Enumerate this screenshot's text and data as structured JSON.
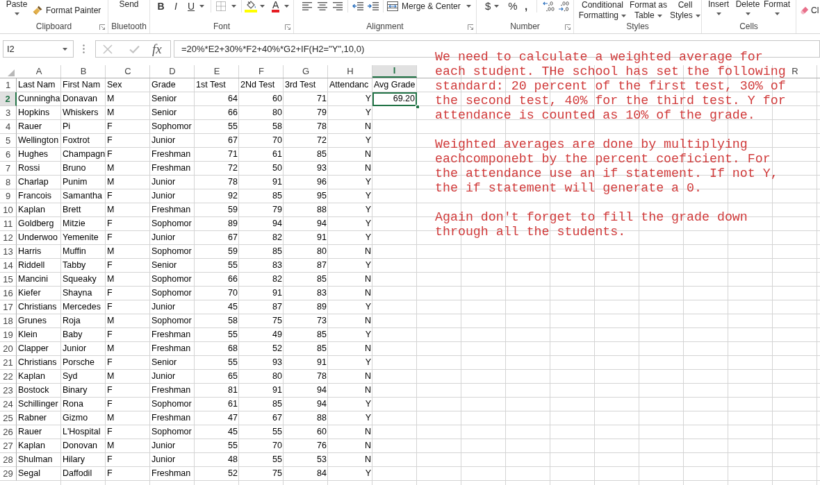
{
  "ribbon": {
    "clipboard": {
      "paste": "Paste",
      "format_painter": "Format Painter",
      "label": "Clipboard"
    },
    "bluetooth": {
      "send": "Send",
      "label": "Bluetooth"
    },
    "font": {
      "bold": "B",
      "italic": "I",
      "underline": "U",
      "font_color": "A",
      "label": "Font"
    },
    "alignment": {
      "merge": "Merge & Center",
      "label": "Alignment"
    },
    "number": {
      "currency": "$",
      "percent": "%",
      "comma": ",",
      "label": "Number"
    },
    "styles": {
      "buttons": [
        "Conditional Formatting",
        "Format as Table",
        "Cell Styles"
      ],
      "label": "Styles"
    },
    "cells": {
      "buttons": [
        "Insert",
        "Delete",
        "Format"
      ],
      "label": "Cells"
    },
    "editing": {
      "clear": "Cl"
    }
  },
  "formula_bar": {
    "name_box": "I2",
    "function_button": "fx",
    "formula": "=20%*E2+30%*F2+40%*G2+IF(H2=\"Y\",10,0)"
  },
  "sheet": {
    "columns": [
      {
        "label": "A",
        "kind": "text",
        "selected": false
      },
      {
        "label": "B",
        "kind": "text",
        "selected": false
      },
      {
        "label": "C",
        "kind": "text",
        "selected": false
      },
      {
        "label": "D",
        "kind": "text",
        "selected": false
      },
      {
        "label": "E",
        "kind": "numeric",
        "selected": false
      },
      {
        "label": "F",
        "kind": "numeric",
        "selected": false
      },
      {
        "label": "G",
        "kind": "numeric",
        "selected": false
      },
      {
        "label": "H",
        "kind": "flag",
        "selected": false
      },
      {
        "label": "I",
        "kind": "numeric",
        "selected": true
      },
      {
        "selected": false
      },
      {
        "selected": false
      },
      {
        "selected": false
      },
      {
        "selected": false
      },
      {
        "selected": false
      },
      {
        "selected": false
      },
      {
        "selected": false
      },
      {
        "selected": false
      },
      {
        "label": "R",
        "selected": false
      }
    ],
    "rows": [
      {
        "label": "1",
        "kind": "header",
        "selected": false,
        "cells": [
          "Last Nam",
          "First Nam",
          "Sex",
          "Grade",
          "1st Test",
          "2Nd Test",
          "3rd Test",
          "Attendanc",
          "Avg Grade"
        ]
      },
      {
        "label": "2",
        "kind": "data",
        "selected": true,
        "cells": [
          "Cunningha",
          "Donavan",
          "M",
          "Senior",
          "64",
          "60",
          "71",
          "Y",
          "69.20"
        ]
      },
      {
        "label": "3",
        "kind": "data",
        "selected": false,
        "cells": [
          "Hopkins",
          "Whiskers",
          "M",
          "Senior",
          "66",
          "80",
          "79",
          "Y"
        ]
      },
      {
        "label": "4",
        "kind": "data",
        "selected": false,
        "cells": [
          "Rauer",
          "Pi",
          "F",
          "Sophomor",
          "55",
          "58",
          "78",
          "N"
        ]
      },
      {
        "label": "5",
        "kind": "data",
        "selected": false,
        "cells": [
          "Wellington",
          "Foxtrot",
          "F",
          "Junior",
          "67",
          "70",
          "72",
          "Y"
        ]
      },
      {
        "label": "6",
        "kind": "data",
        "selected": false,
        "cells": [
          "Hughes",
          "Champagn",
          "F",
          "Freshman",
          "71",
          "61",
          "85",
          "N"
        ]
      },
      {
        "label": "7",
        "kind": "data",
        "selected": false,
        "cells": [
          "Rossi",
          "Bruno",
          "M",
          "Freshman",
          "72",
          "50",
          "93",
          "N"
        ]
      },
      {
        "label": "8",
        "kind": "data",
        "selected": false,
        "cells": [
          "Charlap",
          "Punim",
          "M",
          "Junior",
          "78",
          "91",
          "96",
          "Y"
        ]
      },
      {
        "label": "9",
        "kind": "data",
        "selected": false,
        "cells": [
          "Francois",
          "Samantha",
          "F",
          "Junior",
          "92",
          "85",
          "95",
          "Y"
        ]
      },
      {
        "label": "10",
        "kind": "data",
        "selected": false,
        "cells": [
          "Kaplan",
          "Brett",
          "M",
          "Freshman",
          "59",
          "79",
          "88",
          "Y"
        ]
      },
      {
        "label": "11",
        "kind": "data",
        "selected": false,
        "cells": [
          "Goldberg",
          "Mitzie",
          "F",
          "Sophomor",
          "89",
          "94",
          "94",
          "Y"
        ]
      },
      {
        "label": "12",
        "kind": "data",
        "selected": false,
        "cells": [
          "Underwoo",
          "Yemenite",
          "F",
          "Junior",
          "67",
          "82",
          "91",
          "Y"
        ]
      },
      {
        "label": "13",
        "kind": "data",
        "selected": false,
        "cells": [
          "Harris",
          "Muffin",
          "M",
          "Sophomor",
          "59",
          "85",
          "80",
          "N"
        ]
      },
      {
        "label": "14",
        "kind": "data",
        "selected": false,
        "cells": [
          "Riddell",
          "Tabby",
          "F",
          "Senior",
          "55",
          "83",
          "87",
          "Y"
        ]
      },
      {
        "label": "15",
        "kind": "data",
        "selected": false,
        "cells": [
          "Mancini",
          "Squeaky",
          "M",
          "Sophomor",
          "66",
          "82",
          "85",
          "N"
        ]
      },
      {
        "label": "16",
        "kind": "data",
        "selected": false,
        "cells": [
          "Kiefer",
          "Shayna",
          "F",
          "Sophomor",
          "70",
          "91",
          "83",
          "N"
        ]
      },
      {
        "label": "17",
        "kind": "data",
        "selected": false,
        "cells": [
          "Christians",
          "Mercedes",
          "F",
          "Junior",
          "45",
          "87",
          "89",
          "Y"
        ]
      },
      {
        "label": "18",
        "kind": "data",
        "selected": false,
        "cells": [
          "Grunes",
          "Roja",
          "M",
          "Sophomor",
          "58",
          "75",
          "73",
          "N"
        ]
      },
      {
        "label": "19",
        "kind": "data",
        "selected": false,
        "cells": [
          "Klein",
          "Baby",
          "F",
          "Freshman",
          "55",
          "49",
          "85",
          "Y"
        ]
      },
      {
        "label": "20",
        "kind": "data",
        "selected": false,
        "cells": [
          "Clapper",
          "Junior",
          "M",
          "Freshman",
          "68",
          "52",
          "85",
          "N"
        ]
      },
      {
        "label": "21",
        "kind": "data",
        "selected": false,
        "cells": [
          "Christians",
          "Porsche",
          "F",
          "Senior",
          "55",
          "93",
          "91",
          "Y"
        ]
      },
      {
        "label": "22",
        "kind": "data",
        "selected": false,
        "cells": [
          "Kaplan",
          "Syd",
          "M",
          "Junior",
          "65",
          "80",
          "78",
          "N"
        ]
      },
      {
        "label": "23",
        "kind": "data",
        "selected": false,
        "cells": [
          "Bostock",
          "Binary",
          "F",
          "Freshman",
          "81",
          "91",
          "94",
          "N"
        ]
      },
      {
        "label": "24",
        "kind": "data",
        "selected": false,
        "cells": [
          "Schillinger",
          "Rona",
          "F",
          "Sophomor",
          "61",
          "85",
          "94",
          "Y"
        ]
      },
      {
        "label": "25",
        "kind": "data",
        "selected": false,
        "cells": [
          "Rabner",
          "Gizmo",
          "M",
          "Freshman",
          "47",
          "67",
          "88",
          "Y"
        ]
      },
      {
        "label": "26",
        "kind": "data",
        "selected": false,
        "cells": [
          "Rauer",
          "L'Hospital",
          "F",
          "Sophomor",
          "45",
          "55",
          "60",
          "N"
        ]
      },
      {
        "label": "27",
        "kind": "data",
        "selected": false,
        "cells": [
          "Kaplan",
          "Donovan",
          "M",
          "Junior",
          "55",
          "70",
          "76",
          "N"
        ]
      },
      {
        "label": "28",
        "kind": "data",
        "selected": false,
        "cells": [
          "Shulman",
          "Hilary",
          "F",
          "Junior",
          "48",
          "55",
          "53",
          "N"
        ]
      },
      {
        "label": "29",
        "kind": "data",
        "selected": false,
        "cells": [
          "Segal",
          "Daffodil",
          "F",
          "Freshman",
          "52",
          "75",
          "84",
          "Y"
        ]
      }
    ]
  },
  "note": {
    "paragraphs": [
      "We need to calculate a weighted average for each student. THe school has set the following standard: 20 percent of the first test, 30% of the second test, 40% for the third test. Y for attendance is counted as 10% of the grade.",
      "Weighted averages are done by multiplying eachcomponebt by the percent coeficient. For the attendance use an if statement. If not Y, the if statement will generate a 0.",
      "Again don't forget to fill the grade down through all the students."
    ]
  }
}
